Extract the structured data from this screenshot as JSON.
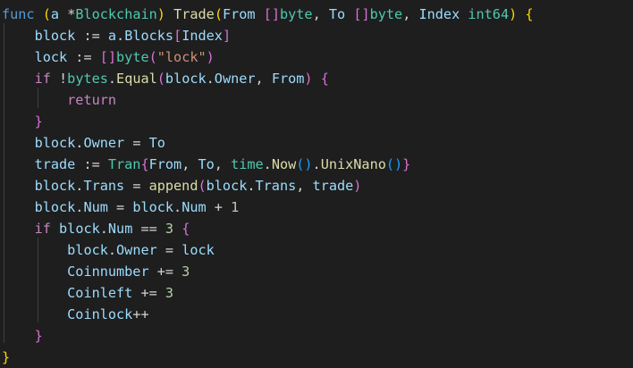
{
  "editor": {
    "lines": [
      [
        {
          "t": "func",
          "c": "kw"
        },
        {
          "t": " ",
          "c": "op"
        },
        {
          "t": "(",
          "c": "b1"
        },
        {
          "t": "a",
          "c": "var"
        },
        {
          "t": " *",
          "c": "op"
        },
        {
          "t": "Blockchain",
          "c": "typ"
        },
        {
          "t": ")",
          "c": "b1"
        },
        {
          "t": " ",
          "c": "op"
        },
        {
          "t": "Trade",
          "c": "fn"
        },
        {
          "t": "(",
          "c": "b1"
        },
        {
          "t": "From",
          "c": "var"
        },
        {
          "t": " ",
          "c": "op"
        },
        {
          "t": "[]",
          "c": "b2"
        },
        {
          "t": "byte",
          "c": "typ"
        },
        {
          "t": ", ",
          "c": "op"
        },
        {
          "t": "To",
          "c": "var"
        },
        {
          "t": " ",
          "c": "op"
        },
        {
          "t": "[]",
          "c": "b2"
        },
        {
          "t": "byte",
          "c": "typ"
        },
        {
          "t": ", ",
          "c": "op"
        },
        {
          "t": "Index",
          "c": "var"
        },
        {
          "t": " ",
          "c": "op"
        },
        {
          "t": "int64",
          "c": "typ"
        },
        {
          "t": ")",
          "c": "b1"
        },
        {
          "t": " ",
          "c": "op"
        },
        {
          "t": "{",
          "c": "b1"
        }
      ],
      [
        {
          "t": "    ",
          "c": "op"
        },
        {
          "t": "block",
          "c": "var"
        },
        {
          "t": " := ",
          "c": "op"
        },
        {
          "t": "a",
          "c": "var"
        },
        {
          "t": ".",
          "c": "op"
        },
        {
          "t": "Blocks",
          "c": "var"
        },
        {
          "t": "[",
          "c": "b2"
        },
        {
          "t": "Index",
          "c": "var"
        },
        {
          "t": "]",
          "c": "b2"
        }
      ],
      [
        {
          "t": "    ",
          "c": "op"
        },
        {
          "t": "lock",
          "c": "var"
        },
        {
          "t": " := ",
          "c": "op"
        },
        {
          "t": "[]",
          "c": "b2"
        },
        {
          "t": "byte",
          "c": "typ"
        },
        {
          "t": "(",
          "c": "b2"
        },
        {
          "t": "\"lock\"",
          "c": "str"
        },
        {
          "t": ")",
          "c": "b2"
        }
      ],
      [
        {
          "t": "    ",
          "c": "op"
        },
        {
          "t": "if",
          "c": "ctl"
        },
        {
          "t": " !",
          "c": "op"
        },
        {
          "t": "bytes",
          "c": "typ"
        },
        {
          "t": ".",
          "c": "op"
        },
        {
          "t": "Equal",
          "c": "fn"
        },
        {
          "t": "(",
          "c": "b2"
        },
        {
          "t": "block",
          "c": "var"
        },
        {
          "t": ".",
          "c": "op"
        },
        {
          "t": "Owner",
          "c": "var"
        },
        {
          "t": ", ",
          "c": "op"
        },
        {
          "t": "From",
          "c": "var"
        },
        {
          "t": ")",
          "c": "b2"
        },
        {
          "t": " ",
          "c": "op"
        },
        {
          "t": "{",
          "c": "b2"
        }
      ],
      [
        {
          "t": "        ",
          "c": "op"
        },
        {
          "t": "return",
          "c": "ctl"
        }
      ],
      [
        {
          "t": "    ",
          "c": "op"
        },
        {
          "t": "}",
          "c": "b2"
        }
      ],
      [
        {
          "t": "    ",
          "c": "op"
        },
        {
          "t": "block",
          "c": "var"
        },
        {
          "t": ".",
          "c": "op"
        },
        {
          "t": "Owner",
          "c": "var"
        },
        {
          "t": " = ",
          "c": "op"
        },
        {
          "t": "To",
          "c": "var"
        }
      ],
      [
        {
          "t": "    ",
          "c": "op"
        },
        {
          "t": "trade",
          "c": "var"
        },
        {
          "t": " := ",
          "c": "op"
        },
        {
          "t": "Tran",
          "c": "typ"
        },
        {
          "t": "{",
          "c": "b2"
        },
        {
          "t": "From",
          "c": "var"
        },
        {
          "t": ", ",
          "c": "op"
        },
        {
          "t": "To",
          "c": "var"
        },
        {
          "t": ", ",
          "c": "op"
        },
        {
          "t": "time",
          "c": "typ"
        },
        {
          "t": ".",
          "c": "op"
        },
        {
          "t": "Now",
          "c": "fn"
        },
        {
          "t": "()",
          "c": "b3"
        },
        {
          "t": ".",
          "c": "op"
        },
        {
          "t": "UnixNano",
          "c": "fn"
        },
        {
          "t": "()",
          "c": "b3"
        },
        {
          "t": "}",
          "c": "b2"
        }
      ],
      [
        {
          "t": "    ",
          "c": "op"
        },
        {
          "t": "block",
          "c": "var"
        },
        {
          "t": ".",
          "c": "op"
        },
        {
          "t": "Trans",
          "c": "var"
        },
        {
          "t": " = ",
          "c": "op"
        },
        {
          "t": "append",
          "c": "fn"
        },
        {
          "t": "(",
          "c": "b2"
        },
        {
          "t": "block",
          "c": "var"
        },
        {
          "t": ".",
          "c": "op"
        },
        {
          "t": "Trans",
          "c": "var"
        },
        {
          "t": ", ",
          "c": "op"
        },
        {
          "t": "trade",
          "c": "var"
        },
        {
          "t": ")",
          "c": "b2"
        }
      ],
      [
        {
          "t": "    ",
          "c": "op"
        },
        {
          "t": "block",
          "c": "var"
        },
        {
          "t": ".",
          "c": "op"
        },
        {
          "t": "Num",
          "c": "var"
        },
        {
          "t": " = ",
          "c": "op"
        },
        {
          "t": "block",
          "c": "var"
        },
        {
          "t": ".",
          "c": "op"
        },
        {
          "t": "Num",
          "c": "var"
        },
        {
          "t": " + ",
          "c": "op"
        },
        {
          "t": "1",
          "c": "num"
        }
      ],
      [
        {
          "t": "    ",
          "c": "op"
        },
        {
          "t": "if",
          "c": "ctl"
        },
        {
          "t": " ",
          "c": "op"
        },
        {
          "t": "block",
          "c": "var"
        },
        {
          "t": ".",
          "c": "op"
        },
        {
          "t": "Num",
          "c": "var"
        },
        {
          "t": " == ",
          "c": "op"
        },
        {
          "t": "3",
          "c": "num"
        },
        {
          "t": " ",
          "c": "op"
        },
        {
          "t": "{",
          "c": "b2"
        }
      ],
      [
        {
          "t": "        ",
          "c": "op"
        },
        {
          "t": "block",
          "c": "var"
        },
        {
          "t": ".",
          "c": "op"
        },
        {
          "t": "Owner",
          "c": "var"
        },
        {
          "t": " = ",
          "c": "op"
        },
        {
          "t": "lock",
          "c": "var"
        }
      ],
      [
        {
          "t": "        ",
          "c": "op"
        },
        {
          "t": "Coinnumber",
          "c": "var"
        },
        {
          "t": " += ",
          "c": "op"
        },
        {
          "t": "3",
          "c": "num"
        }
      ],
      [
        {
          "t": "        ",
          "c": "op"
        },
        {
          "t": "Coinleft",
          "c": "var"
        },
        {
          "t": " += ",
          "c": "op"
        },
        {
          "t": "3",
          "c": "num"
        }
      ],
      [
        {
          "t": "        ",
          "c": "op"
        },
        {
          "t": "Coinlock",
          "c": "var"
        },
        {
          "t": "++",
          "c": "op"
        }
      ],
      [
        {
          "t": "    ",
          "c": "op"
        },
        {
          "t": "}",
          "c": "b2"
        }
      ],
      [
        {
          "t": "}",
          "c": "b1"
        }
      ]
    ]
  }
}
